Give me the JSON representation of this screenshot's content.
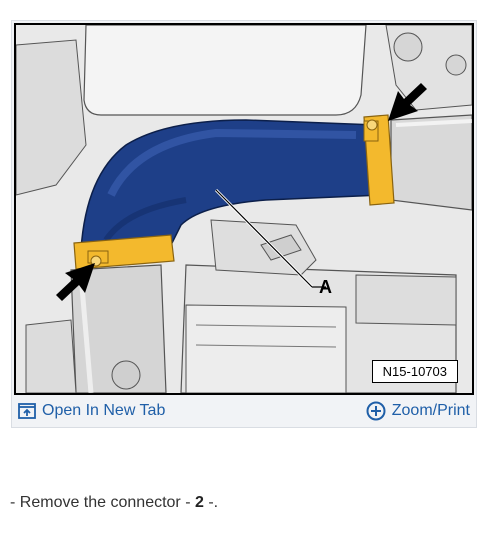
{
  "figure": {
    "code": "N15-10703",
    "callout_label": "A"
  },
  "toolbar": {
    "open_tab_label": "Open In New Tab",
    "zoom_print_label": "Zoom/Print"
  },
  "instruction": {
    "bullet": "-",
    "text_before": "Remove the connector -",
    "part_number": "2",
    "text_after": "-."
  },
  "colors": {
    "hose_blue": "#1e3f88",
    "clamp_yellow": "#f3b92d",
    "link_blue": "#1f5fa8"
  }
}
